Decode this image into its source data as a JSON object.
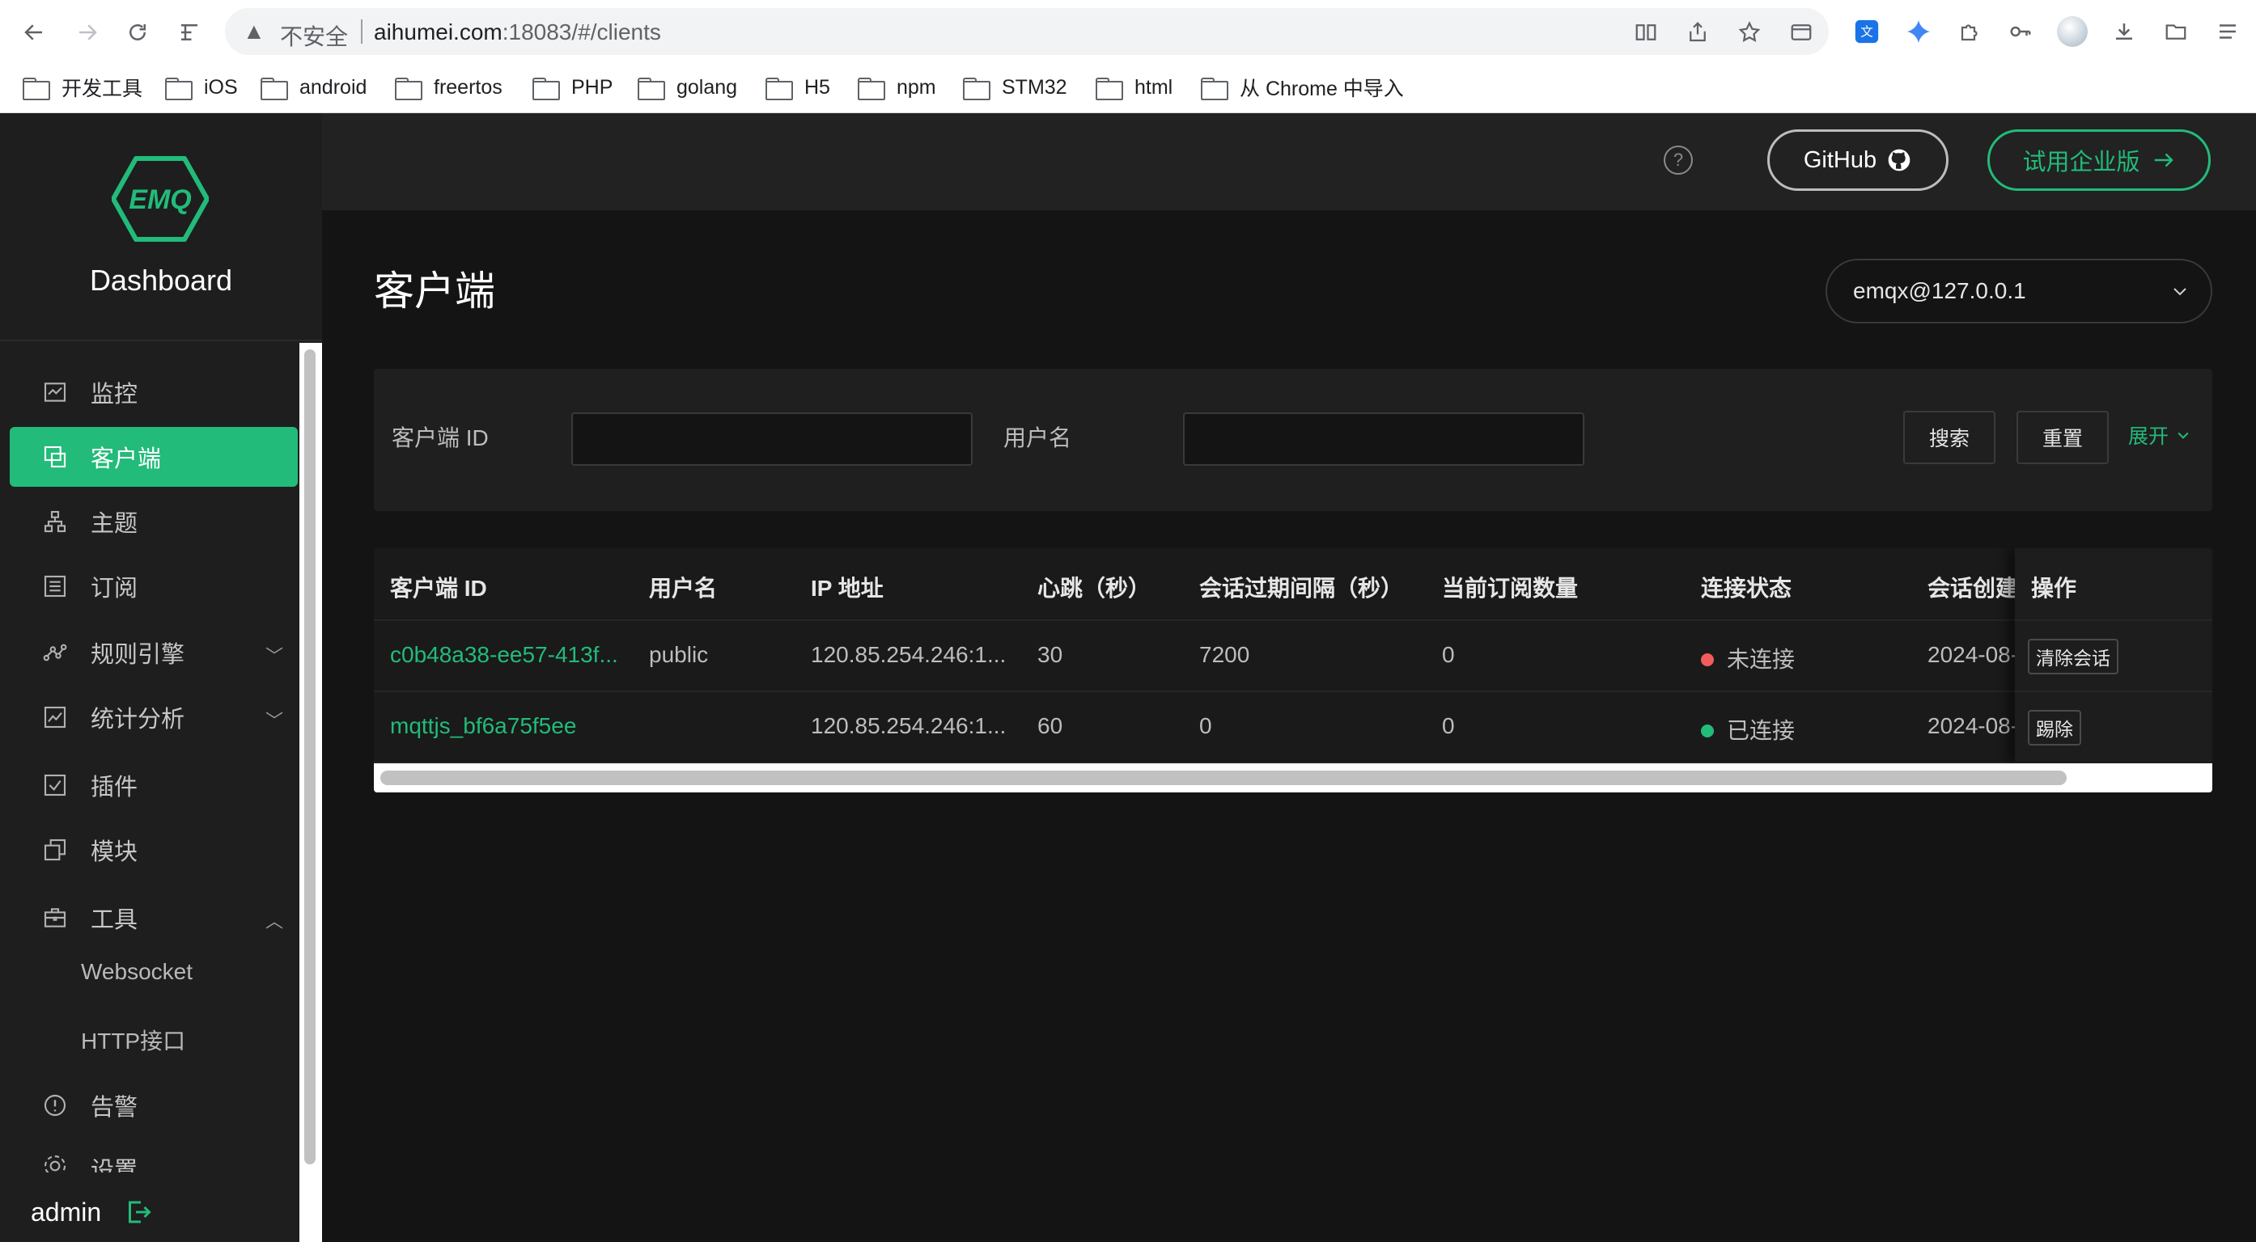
{
  "browser": {
    "insecure_label": "不安全",
    "url_host": "aihumei.com",
    "url_rest": ":18083/#/clients",
    "bookmarks": [
      "开发工具",
      "iOS",
      "android",
      "freertos",
      "PHP",
      "golang",
      "H5",
      "npm",
      "STM32",
      "html",
      "从 Chrome 中导入"
    ]
  },
  "sidebar": {
    "brand_logo_text": "EMQ",
    "brand_title": "Dashboard",
    "items": [
      {
        "label": "监控",
        "icon": "monitor-chart-icon"
      },
      {
        "label": "客户端",
        "icon": "clients-icon",
        "active": true
      },
      {
        "label": "主题",
        "icon": "topic-tree-icon"
      },
      {
        "label": "订阅",
        "icon": "subscription-list-icon"
      },
      {
        "label": "规则引擎",
        "icon": "rule-engine-icon",
        "expandable": true
      },
      {
        "label": "统计分析",
        "icon": "analytics-icon",
        "expandable": true
      },
      {
        "label": "插件",
        "icon": "plugin-check-icon"
      },
      {
        "label": "模块",
        "icon": "module-icon"
      },
      {
        "label": "工具",
        "icon": "toolbox-icon",
        "expanded": true
      },
      {
        "label": "告警",
        "icon": "alarm-icon"
      },
      {
        "label": "设置",
        "icon": "settings-icon"
      }
    ],
    "tool_subitems": [
      "Websocket",
      "HTTP接口"
    ],
    "username": "admin"
  },
  "topbar": {
    "github_label": "GitHub",
    "enterprise_label": "试用企业版"
  },
  "page": {
    "title": "客户端",
    "node_selected": "emqx@127.0.0.1"
  },
  "filter": {
    "client_id_label": "客户端 ID",
    "client_id_value": "",
    "username_label": "用户名",
    "username_value": "",
    "search_label": "搜索",
    "reset_label": "重置",
    "expand_label": "展开"
  },
  "table": {
    "columns": [
      "客户端 ID",
      "用户名",
      "IP 地址",
      "心跳（秒）",
      "会话过期间隔（秒）",
      "当前订阅数量",
      "连接状态",
      "会话创建",
      "操作"
    ],
    "rows": [
      {
        "client_id": "c0b48a38-ee57-413f...",
        "username": "public",
        "ip": "120.85.254.246:1...",
        "keepalive": "30",
        "expiry": "7200",
        "subs": "0",
        "status": "未连接",
        "status_color": "#f25c5c",
        "created": "2024-08-",
        "action": "清除会话"
      },
      {
        "client_id": "mqttjs_bf6a75f5ee",
        "username": "",
        "ip": "120.85.254.246:1...",
        "keepalive": "60",
        "expiry": "0",
        "subs": "0",
        "status": "已连接",
        "status_color": "#22bb7a",
        "created": "2024-08-",
        "action": "踢除"
      }
    ]
  },
  "colors": {
    "accent": "#22bb7a",
    "sidebar_bg": "#1e1e1e",
    "main_bg": "#141414",
    "disconnected": "#f25c5c"
  }
}
